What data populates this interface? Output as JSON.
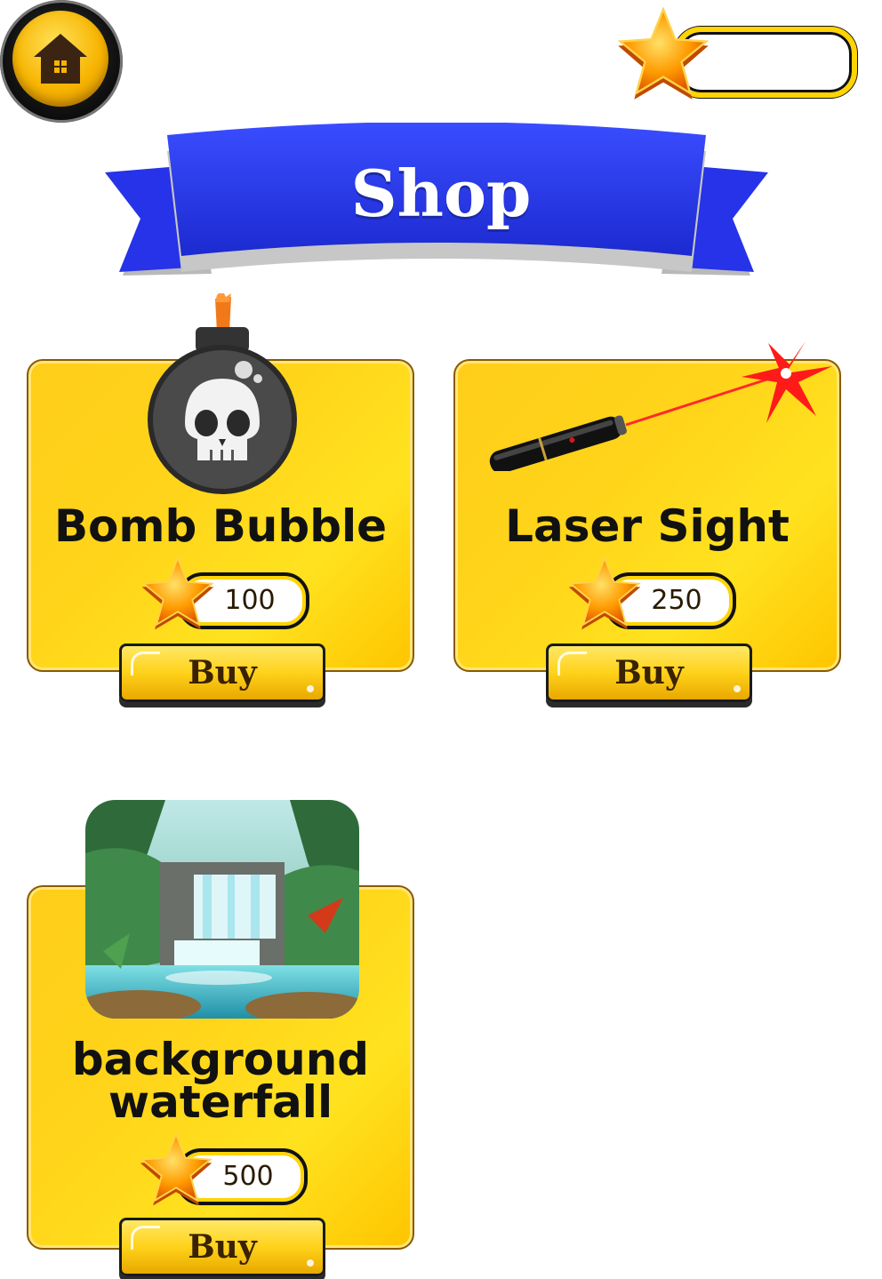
{
  "header": {
    "home_icon": "home-icon",
    "star_icon": "star-icon",
    "star_count": ""
  },
  "banner": {
    "title": "Shop"
  },
  "items": [
    {
      "name": "Bomb Bubble",
      "icon": "skull-bomb-icon",
      "price": "100",
      "buy_label": "Buy"
    },
    {
      "name": "Laser Sight",
      "icon": "laser-pointer-icon",
      "price": "250",
      "buy_label": "Buy"
    },
    {
      "name_line1": "background",
      "name_line2": "waterfall",
      "icon": "waterfall-image",
      "price": "500",
      "buy_label": "Buy"
    }
  ],
  "colors": {
    "card": "#ffd41a",
    "banner": "#2a3fe0",
    "button": "#ffd21a",
    "star": "#ffb300"
  }
}
